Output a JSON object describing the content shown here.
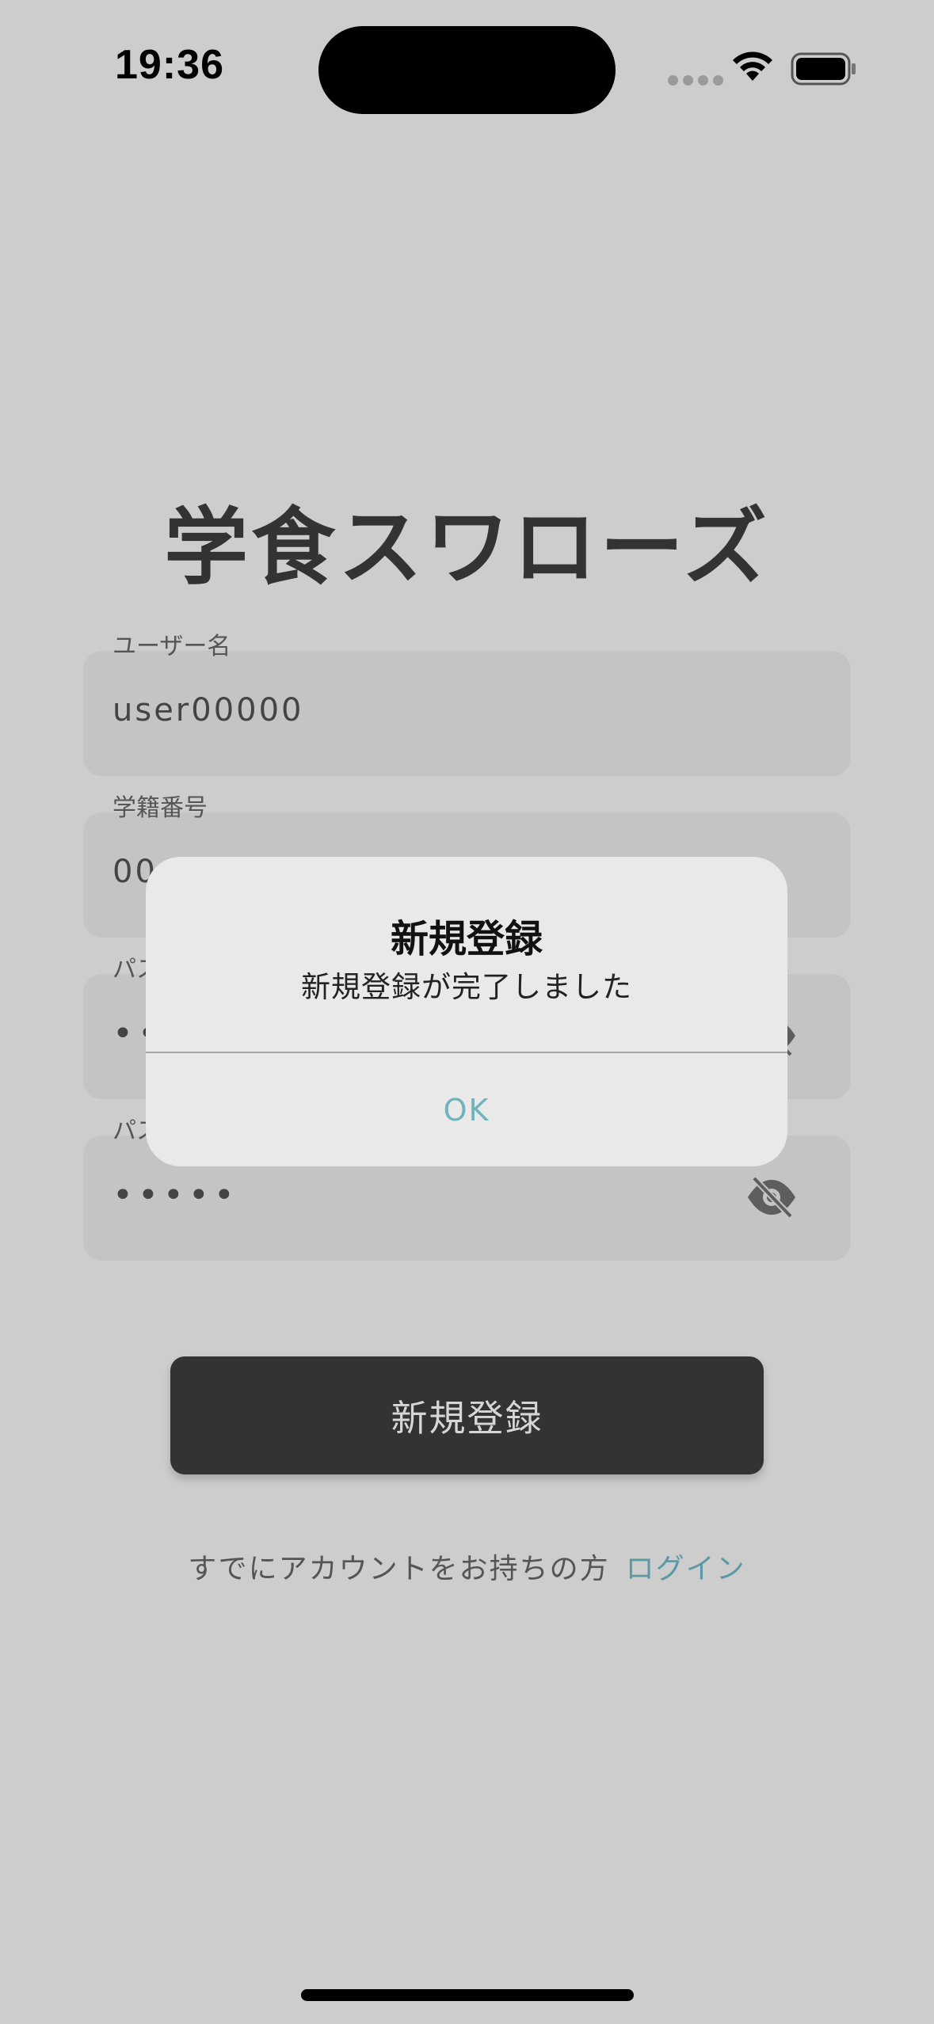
{
  "status_bar": {
    "time": "19:36"
  },
  "app": {
    "title": "学食スワローズ"
  },
  "form": {
    "fields": [
      {
        "label": "ユーザー名",
        "value": "user00000",
        "type": "text"
      },
      {
        "label": "学籍番号",
        "value": "00",
        "type": "text"
      },
      {
        "label": "パス",
        "value": "••",
        "type": "password"
      },
      {
        "label": "パス",
        "value": "•••••",
        "type": "password"
      }
    ],
    "register_button_label": "新規登録",
    "login_prompt": "すでにアカウントをお持ちの方",
    "login_link_label": "ログイン"
  },
  "alert": {
    "title": "新規登録",
    "message": "新規登録が完了しました",
    "ok_label": "OK"
  },
  "colors": {
    "background": "#cdcdcd",
    "field_background": "#c4c4c4",
    "button_background": "#333333",
    "link": "#5c9aa3",
    "alert_ok": "#6fb3bb"
  },
  "icons": {
    "password_toggle": "eye-slash-icon",
    "wifi": "wifi-icon",
    "battery": "battery-icon"
  }
}
